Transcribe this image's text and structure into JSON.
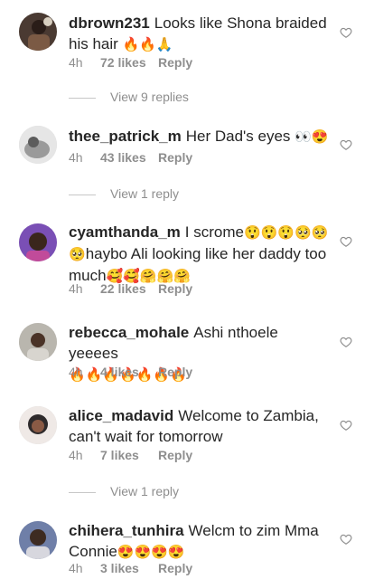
{
  "comments": [
    {
      "username": "dbrown231",
      "text": "Looks like Shona braided his hair",
      "emoji": "🔥🔥🙏",
      "time": "4h",
      "likes": "72 likes",
      "reply": "Reply",
      "avatar_color": "#4a3a32"
    },
    {
      "username": "thee_patrick_m",
      "text": "Her Dad's eyes",
      "emoji": "👀😍",
      "time": "4h",
      "likes": "43 likes",
      "reply": "Reply",
      "avatar_color": "#9a9a9a"
    },
    {
      "username": "cyamthanda_m",
      "text": "I scrome",
      "emoji": "😲😲😲🥺🥺",
      "text2_emoji": "🥺",
      "text2": "haybo Ali looking like her daddy too much",
      "emoji2": "🥰🥰🤗🤗🤗",
      "time": "4h",
      "likes": "22 likes",
      "reply": "Reply",
      "avatar_color": "#7a4fb5"
    },
    {
      "username": "rebecca_mohale",
      "text": "Ashi nthoele yeeees",
      "emoji": "🔥🔥🔥🔥🔥🔥🔥",
      "time": "4h",
      "likes": "4 likes",
      "reply": "Reply",
      "avatar_color": "#b9b6ae"
    },
    {
      "username": "alice_madavid",
      "text": "Welcome to Zambia, can't wait for tomorrow",
      "time": "4h",
      "likes": "7 likes",
      "reply": "Reply",
      "avatar_color": "#2e2a2b"
    },
    {
      "username": "chihera_tunhira",
      "text": "Welcm to zim Mma Connie",
      "emoji": "😍😍😍😍",
      "time": "4h",
      "likes": "3 likes",
      "reply": "Reply",
      "avatar_color": "#6f7fa8"
    }
  ],
  "view_replies": [
    "View 9 replies",
    "View 1 reply",
    "View 1 reply"
  ],
  "colors": {
    "text": "#262626",
    "secondary": "#8e8e8e",
    "background": "#ffffff"
  },
  "icons": {
    "like": "heart-outline-icon"
  }
}
